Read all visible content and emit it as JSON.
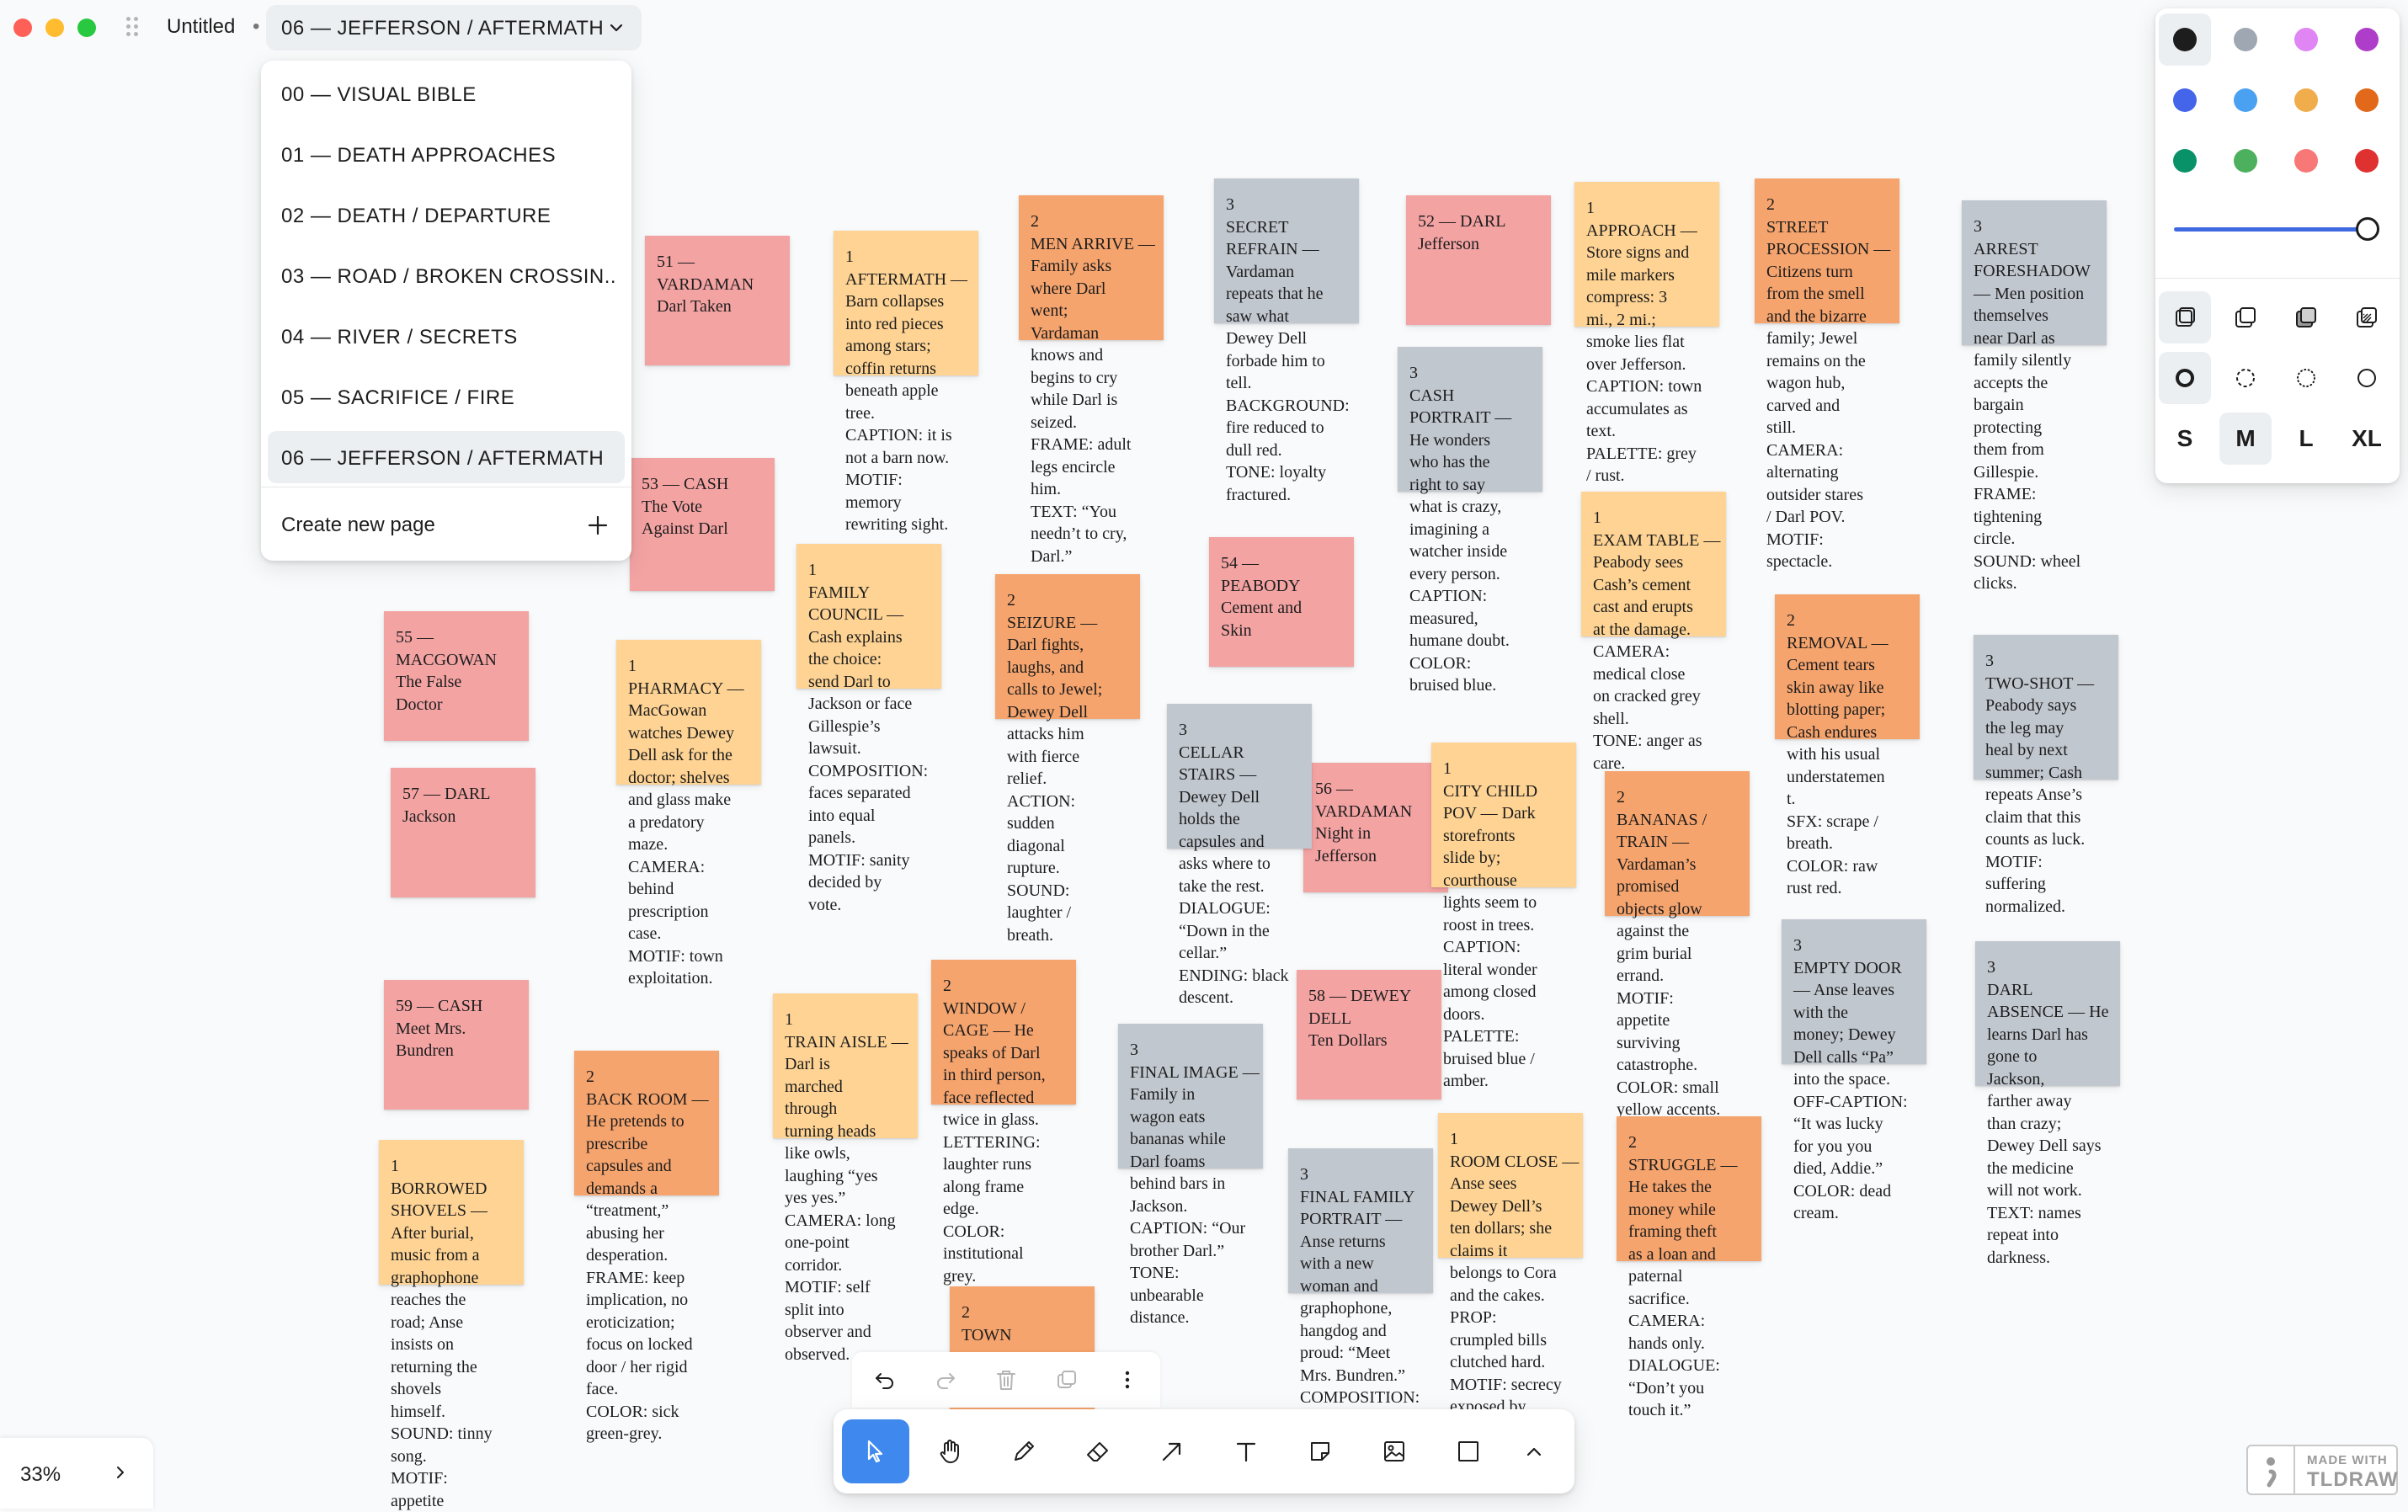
{
  "window": {
    "title": "Untitled",
    "separator": "•"
  },
  "current_page": "06 — JEFFERSON / AFTERMATH",
  "page_menu": {
    "pages": [
      "00 — VISUAL BIBLE",
      "01 — DEATH APPROACHES",
      "02 — DEATH / DEPARTURE",
      "03 — ROAD / BROKEN CROSSIN...",
      "04 — RIVER / SECRETS",
      "05 — SACRIFICE / FIRE",
      "06 — JEFFERSON / AFTERMATH"
    ],
    "active_index": 6,
    "create_label": "Create new page",
    "create_icon": "plus-icon"
  },
  "notes": [
    {
      "color": "red",
      "text": "51 —\nVARDAMAN\nDarl Taken"
    },
    {
      "color": "red",
      "text": "53 — CASH\nThe Vote\nAgainst Darl"
    },
    {
      "color": "red",
      "text": "55 —\nMACGOWAN\nThe False\nDoctor"
    },
    {
      "color": "red",
      "text": "57 — DARL\nJackson"
    },
    {
      "color": "red",
      "text": "59 — CASH\nMeet Mrs.\nBundren"
    },
    {
      "color": "red",
      "text": "52 — DARL\nJefferson"
    },
    {
      "color": "red",
      "text": "54 —\nPEABODY\nCement and\nSkin"
    },
    {
      "color": "red",
      "text": "56 —\nVARDAMAN\nNight in\nJefferson"
    },
    {
      "color": "red",
      "text": "58 — DEWEY\nDELL\nTen Dollars"
    },
    {
      "color": "yellow",
      "text": "1\nAFTERMATH —\nBarn collapses\ninto red pieces\namong stars;\ncoffin returns\nbeneath apple\ntree.\nCAPTION: it is\nnot a barn now.\nMOTIF:\nmemory\nrewriting sight."
    },
    {
      "color": "yellow",
      "text": "1\nFAMILY\nCOUNCIL —\nCash explains\nthe choice:\nsend Darl to\nJackson or face\nGillespie’s\nlawsuit.\nCOMPOSITION:\nfaces separated\ninto equal\npanels.\nMOTIF: sanity\ndecided by\nvote."
    },
    {
      "color": "yellow",
      "text": "1\nPHARMACY —\nMacGowan\nwatches Dewey\nDell ask for the\ndoctor; shelves\nand glass make\na predatory\nmaze.\nCAMERA:\nbehind\nprescription\ncase.\nMOTIF: town\nexploitation."
    },
    {
      "color": "yellow",
      "text": "1\nTRAIN AISLE —\nDarl is\nmarched\nthrough\nturning heads\nlike owls,\nlaughing “yes\nyes yes.”\nCAMERA: long\none-point\ncorridor.\nMOTIF: self\nsplit into\nobserver and\nobserved."
    },
    {
      "color": "yellow",
      "text": "1\nBORROWED\nSHOVELS —\nAfter burial,\nmusic from a\ngraphophone\nreaches the\nroad; Anse\ninsists on\nreturning the\nshovels\nhimself.\nSOUND: tinny\nsong.\nMOTIF:\nappetite"
    },
    {
      "color": "yellow",
      "text": "1\nAPPROACH —\nStore signs and\nmile markers\ncompress: 3\nmi., 2 mi.;\nsmoke lies flat\nover Jefferson.\nCAPTION: town\naccumulates as\ntext.\nPALETTE: grey\n/ rust."
    },
    {
      "color": "yellow",
      "text": "1\nEXAM TABLE —\nPeabody sees\nCash’s cement\ncast and erupts\nat the damage.\nCAMERA:\nmedical close\non cracked grey\nshell.\nTONE: anger as\ncare."
    },
    {
      "color": "yellow",
      "text": "1\nCITY CHILD\nPOV — Dark\nstorefronts\nslide by;\ncourthouse\nlights seem to\nroost in trees.\nCAPTION:\nliteral wonder\namong closed\ndoors.\nPALETTE:\nbruised blue /\namber."
    },
    {
      "color": "yellow",
      "text": "1\nROOM CLOSE —\nAnse sees\nDewey Dell’s\nten dollars; she\nclaims it\nbelongs to Cora\nand the cakes.\nPROP:\ncrumpled bills\nclutched hard.\nMOTIF: secrecy\nexposed by"
    },
    {
      "color": "orange",
      "text": "2\nMEN ARRIVE —\nFamily asks\nwhere Darl\nwent;\nVardaman\nknows and\nbegins to cry\nwhile Darl is\nseized.\nFRAME: adult\nlegs encircle\nhim.\nTEXT: “You\nneedn’t to cry,\nDarl.”"
    },
    {
      "color": "orange",
      "text": "2\nSEIZURE —\nDarl fights,\nlaughs, and\ncalls to Jewel;\nDewey Dell\nattacks him\nwith fierce\nrelief.\nACTION:\nsudden\ndiagonal\nrupture.\nSOUND:\nlaughter /\nbreath."
    },
    {
      "color": "orange",
      "text": "2\nWINDOW /\nCAGE — He\nspeaks of Darl\nin third person,\nface reflected\ntwice in glass.\nLETTERING:\nlaughter runs\nalong frame\nedge.\nCOLOR:\ninstitutional\ngrey."
    },
    {
      "color": "orange",
      "text": "2\nBACK ROOM —\nHe pretends to\nprescribe\ncapsules and\ndemands a\n“treatment,”\nabusing her\ndesperation.\nFRAME: keep\nimplication, no\neroticization;\nfocus on locked\ndoor / her rigid\nface.\nCOLOR: sick\ngreen-grey."
    },
    {
      "color": "orange",
      "text": "2\nTOWN"
    },
    {
      "color": "orange",
      "text": "2\nSTREET\nPROCESSION —\nCitizens turn\nfrom the smell\nand the bizarre\nfamily; Jewel\nremains on the\nwagon hub,\ncarved and\nstill.\nCAMERA:\nalternating\noutsider stares\n/ Darl POV.\nMOTIF:\nspectacle."
    },
    {
      "color": "orange",
      "text": "2\nREMOVAL —\nCement tears\nskin away like\nblotting paper;\nCash endures\nwith his usual\nunderstatemen\nt.\nSFX: scrape /\nbreath.\nCOLOR: raw\nrust red."
    },
    {
      "color": "orange",
      "text": "2\nBANANAS /\nTRAIN —\nVardaman’s\npromised\nobjects glow\nagainst the\ngrim burial\nerrand.\nMOTIF:\nappetite\nsurviving\ncatastrophe.\nCOLOR: small\nyellow accents."
    },
    {
      "color": "orange",
      "text": "2\nSTRUGGLE —\nHe takes the\nmoney while\nframing theft\nas a loan and\npaternal\nsacrifice.\nCAMERA:\nhands only.\nDIALOGUE:\n“Don’t you\ntouch it.”"
    },
    {
      "color": "grey",
      "text": "3\nSECRET\nREFRAIN —\nVardaman\nrepeats that he\nsaw what\nDewey Dell\nforbade him to\ntell.\nBACKGROUND:\nfire reduced to\ndull red.\nTONE: loyalty\nfractured."
    },
    {
      "color": "grey",
      "text": "3\nCASH\nPORTRAIT —\nHe wonders\nwho has the\nright to say\nwhat is crazy,\nimagining a\nwatcher inside\nevery person.\nCAPTION:\nmeasured,\nhumane doubt.\nCOLOR:\nbruised blue."
    },
    {
      "color": "grey",
      "text": "3\nCELLAR\nSTAIRS —\nDewey Dell\nholds the\ncapsules and\nasks where to\ntake the rest.\nDIALOGUE:\n“Down in the\ncellar.”\nENDING: black\ndescent."
    },
    {
      "color": "grey",
      "text": "3\nFINAL IMAGE —\nFamily in\nwagon eats\nbananas while\nDarl foams\nbehind bars in\nJackson.\nCAPTION: “Our\nbrother Darl.”\nTONE:\nunbearable\ndistance."
    },
    {
      "color": "grey",
      "text": "3\nFINAL FAMILY\nPORTRAIT —\nAnse returns\nwith a new\nwoman and\ngraphophone,\nhangdog and\nproud: “Meet\nMrs. Bundren.”\nCOMPOSITION:"
    },
    {
      "color": "grey",
      "text": "3\nARREST\nFORESHADOW\n— Men position\nthemselves\nnear Darl as\nfamily silently\naccepts the\nbargain\nprotecting\nthem from\nGillespie.\nFRAME:\ntightening\ncircle.\nSOUND: wheel\nclicks."
    },
    {
      "color": "grey",
      "text": "3\nTWO-SHOT —\nPeabody says\nthe leg may\nheal by next\nsummer; Cash\nrepeats Anse’s\nclaim that this\ncounts as luck.\nMOTIF:\nsuffering\nnormalized."
    },
    {
      "color": "grey",
      "text": "3\nEMPTY DOOR\n— Anse leaves\nwith the\nmoney; Dewey\nDell calls “Pa”\ninto the space.\nOFF-CAPTION:\n“It was lucky\nfor you you\ndied, Addie.”\nCOLOR: dead\ncream."
    },
    {
      "color": "grey",
      "text": "3\nDARL\nABSENCE — He\nlearns Darl has\ngone to\nJackson,\nfarther away\nthan crazy;\nDewey Dell says\nthe medicine\nwill not work.\nTEXT: names\nrepeat into\ndarkness."
    }
  ],
  "note_colors": {
    "red": "#f4a3a3",
    "orange": "#f6a46d",
    "yellow": "#fed393",
    "grey": "#c1c7cf"
  },
  "style_panel": {
    "colors": [
      "#1d1d1d",
      "#9fa8b2",
      "#e085f4",
      "#ae3ec9",
      "#4465e9",
      "#4ba1f1",
      "#f1ac4b",
      "#e16919",
      "#099268",
      "#4cb05e",
      "#f87777",
      "#e03131"
    ],
    "selected_color": 0,
    "opacity": 1.0,
    "fill_icons": [
      "fill-none-icon",
      "fill-semi-icon",
      "fill-solid-icon",
      "fill-pattern-icon"
    ],
    "dash_icons": [
      "dash-draw-icon",
      "dash-dashed-icon",
      "dash-dotted-icon",
      "dash-solid-icon"
    ],
    "sizes": [
      "S",
      "M",
      "L",
      "XL"
    ],
    "selected_size": 1
  },
  "quick_actions": [
    "undo-icon",
    "redo-icon",
    "trash-icon",
    "duplicate-icon",
    "more-icon"
  ],
  "tools": [
    "select-tool-icon",
    "hand-tool-icon",
    "draw-tool-icon",
    "eraser-tool-icon",
    "arrow-tool-icon",
    "text-tool-icon",
    "note-tool-icon",
    "image-tool-icon",
    "rectangle-tool-icon",
    "more-tools-icon"
  ],
  "active_tool": 0,
  "zoom": {
    "label": "33%"
  },
  "watermark": {
    "small": "MADE WITH",
    "big": "TLDRAW"
  }
}
